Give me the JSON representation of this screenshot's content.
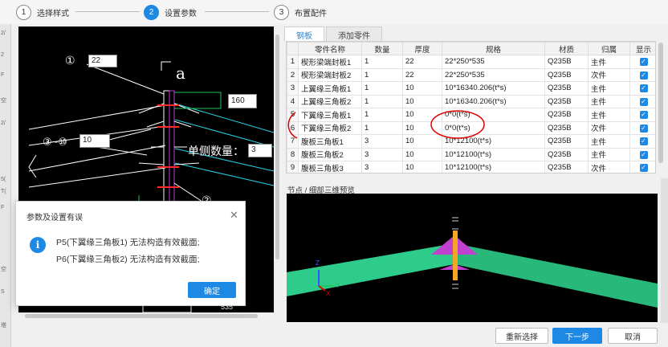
{
  "steps": [
    {
      "num": "1",
      "label": "选择样式"
    },
    {
      "num": "2",
      "label": "设置参数"
    },
    {
      "num": "3",
      "label": "布置配件"
    }
  ],
  "left_edge": {
    "labels": [
      "2/",
      "2",
      "F",
      "空",
      "2/",
      "5(",
      "T(",
      "F",
      "空",
      "S",
      "塔"
    ]
  },
  "cad": {
    "callout1": "①",
    "input1": "22",
    "label_a": "a",
    "input_right": "160",
    "callout3_10": "③~⑩",
    "input_3_10": "10",
    "single_side_label": "单侧数量：",
    "single_side_value": "3",
    "callout_bottom": "②",
    "bottom_value": "535"
  },
  "tabs": [
    {
      "label": "钢板"
    },
    {
      "label": "添加零件"
    }
  ],
  "table": {
    "headers": [
      "",
      "零件名称",
      "数量",
      "厚度",
      "规格",
      "材质",
      "归属",
      "显示"
    ],
    "rows": [
      {
        "idx": "1",
        "name": "楔形梁端封板1",
        "qty": "1",
        "thick": "22",
        "spec": "22*250*535",
        "mat": "Q235B",
        "owner": "主件"
      },
      {
        "idx": "2",
        "name": "楔形梁端封板2",
        "qty": "1",
        "thick": "22",
        "spec": "22*250*535",
        "mat": "Q235B",
        "owner": "次件"
      },
      {
        "idx": "3",
        "name": "上翼缘三角板1",
        "qty": "1",
        "thick": "10",
        "spec": "10*16340.206(t*s)",
        "mat": "Q235B",
        "owner": "主件"
      },
      {
        "idx": "4",
        "name": "上翼缘三角板2",
        "qty": "1",
        "thick": "10",
        "spec": "10*16340.206(t*s)",
        "mat": "Q235B",
        "owner": "主件"
      },
      {
        "idx": "5",
        "name": "下翼缘三角板1",
        "qty": "1",
        "thick": "10",
        "spec": "0*0(t*s)",
        "mat": "Q235B",
        "owner": "主件"
      },
      {
        "idx": "6",
        "name": "下翼缘三角板2",
        "qty": "1",
        "thick": "10",
        "spec": "0*0(t*s)",
        "mat": "Q235B",
        "owner": "次件"
      },
      {
        "idx": "7",
        "name": "腹板三角板1",
        "qty": "3",
        "thick": "10",
        "spec": "10*12100(t*s)",
        "mat": "Q235B",
        "owner": "主件"
      },
      {
        "idx": "8",
        "name": "腹板三角板2",
        "qty": "3",
        "thick": "10",
        "spec": "10*12100(t*s)",
        "mat": "Q235B",
        "owner": "主件"
      },
      {
        "idx": "9",
        "name": "腹板三角板3",
        "qty": "3",
        "thick": "10",
        "spec": "10*12100(t*s)",
        "mat": "Q235B",
        "owner": "次件"
      }
    ]
  },
  "preview": {
    "label": "节点 / 细部三维预览",
    "axis_z": "Z",
    "axis_y": "Y",
    "axis_x": "X"
  },
  "buttons": {
    "reselect": "重新选择",
    "next": "下一步",
    "cancel": "取消"
  },
  "dialog": {
    "title": "参数及设置有误",
    "close": "✕",
    "info_icon": "i",
    "messages": [
      "P5(下翼缘三角板1) 无法构造有效截面;",
      "P6(下翼缘三角板2) 无法构造有效截面;"
    ],
    "ok": "确定"
  },
  "colors": {
    "accent": "#1e88e5",
    "annotation": "#e00000",
    "beam_fill": "#2ecc8a",
    "plate_orange": "#f5a623",
    "plate_magenta": "#c040d0"
  }
}
